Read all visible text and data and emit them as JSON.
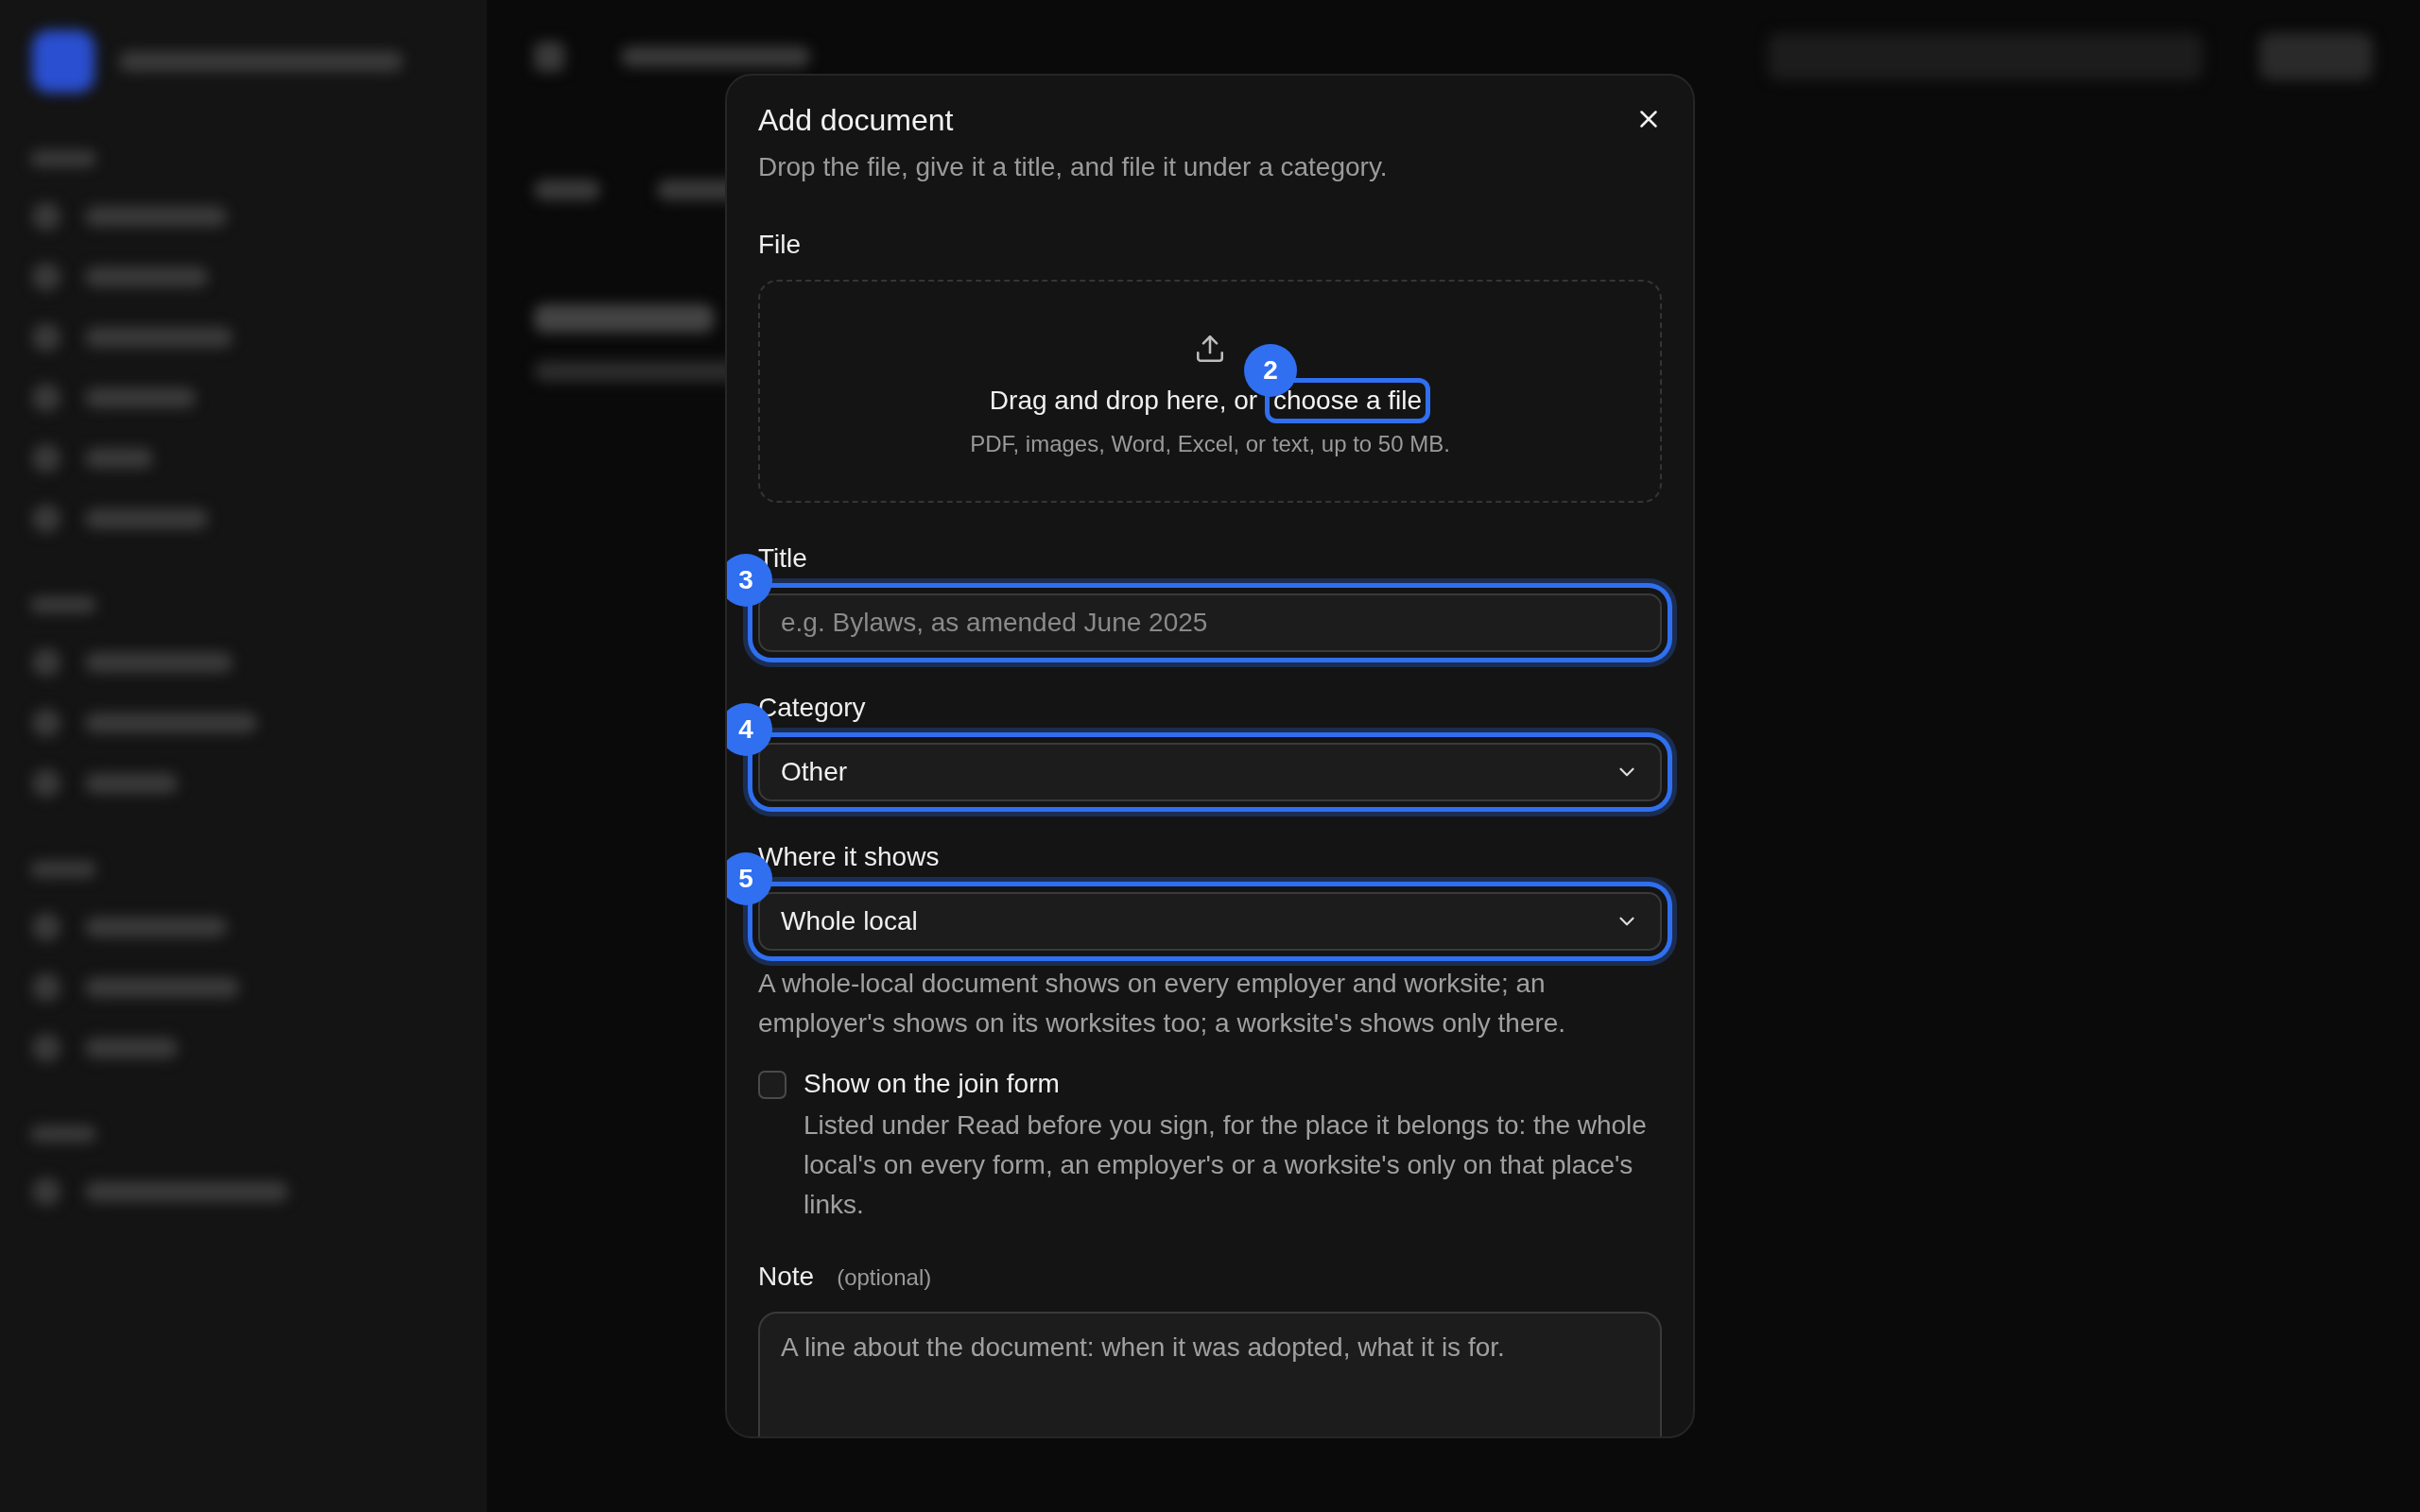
{
  "dialog": {
    "title": "Add document",
    "subtitle": "Drop the file, give it a title, and file it under a category.",
    "file": {
      "label": "File",
      "prompt": "Drag and drop here, or ",
      "link": "choose a file",
      "marker": "2",
      "hint": "PDF, images, Word, Excel, or text, up to 50 MB."
    },
    "fields": [
      {
        "kind": "text",
        "label": "Title",
        "placeholder": "e.g. Bylaws, as amended June 2025",
        "marker": "3"
      },
      {
        "kind": "select",
        "label": "Category",
        "value": "Other",
        "marker": "4"
      },
      {
        "kind": "select",
        "label": "Where it shows",
        "value": "Whole local",
        "marker": "5",
        "help": "A whole-local document shows on every employer and worksite; an employer's shows on its worksites too; a worksite's shows only there."
      }
    ],
    "join_form": {
      "label": "Show on the join form",
      "checked": false,
      "description": "Listed under Read before you sign, for the place it belongs to: the whole local's on every form, an employer's or a worksite's only on that place's links."
    },
    "note": {
      "label": "Note",
      "hint": "(optional)",
      "placeholder": "A line about the document: when it was adopted, what it is for."
    }
  }
}
